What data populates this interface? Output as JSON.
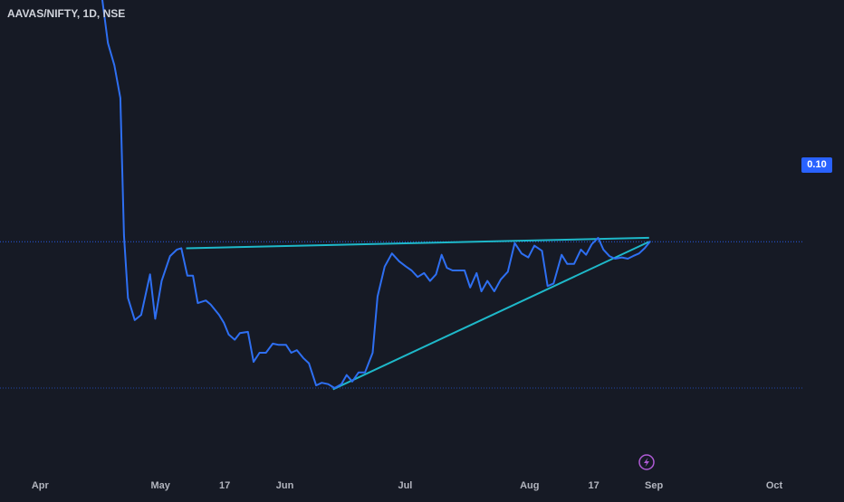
{
  "header": {
    "symbol_title": "AAVAS/NIFTY, 1D, NSE"
  },
  "price_badge": {
    "label": "0.10"
  },
  "colors": {
    "background": "#161a25",
    "series_line": "#2e6ff2",
    "trendline": "#1eb8c9",
    "dotted_line": "#2962ff",
    "lightning_icon": "#b05bd6",
    "axis_text": "#b2b5be"
  },
  "icons": {
    "event_marker": "lightning-icon"
  },
  "chart_data": {
    "type": "line",
    "title": "AAVAS/NIFTY, 1D, NSE",
    "xlabel": "",
    "ylabel": "",
    "x_ticks": [
      "Apr",
      "May",
      "17",
      "Jun",
      "Jul",
      "Aug",
      "17",
      "Sep",
      "Oct"
    ],
    "x_tick_days": [
      0,
      30,
      46,
      61,
      91,
      122,
      138,
      153,
      183
    ],
    "xlim": [
      -10,
      190
    ],
    "ylim": [
      0.0825,
      0.1185
    ],
    "grid": false,
    "legend": "none",
    "last_price": 0.1,
    "reference_lines": [
      {
        "style": "dotted",
        "y": 0.1
      },
      {
        "style": "dotted",
        "y": 0.0888
      }
    ],
    "series": [
      {
        "values": [
          [
            15.5,
            0.1185
          ],
          [
            16.9,
            0.1152
          ],
          [
            18.5,
            0.1135
          ],
          [
            20.0,
            0.111
          ],
          [
            20.9,
            0.1005
          ],
          [
            21.9,
            0.0957
          ],
          [
            23.6,
            0.094
          ],
          [
            25.2,
            0.0944
          ],
          [
            27.4,
            0.0975
          ],
          [
            28.7,
            0.0941
          ],
          [
            30.3,
            0.097
          ],
          [
            32.4,
            0.0989
          ],
          [
            34.1,
            0.0994
          ],
          [
            35.2,
            0.0995
          ],
          [
            36.7,
            0.0974
          ],
          [
            38.1,
            0.0974
          ],
          [
            39.3,
            0.0953
          ],
          [
            41.3,
            0.0955
          ],
          [
            42.5,
            0.0952
          ],
          [
            44.6,
            0.0944
          ],
          [
            45.8,
            0.0938
          ],
          [
            47.0,
            0.0929
          ],
          [
            48.5,
            0.0925
          ],
          [
            49.8,
            0.093
          ],
          [
            51.8,
            0.0931
          ],
          [
            53.2,
            0.0908
          ],
          [
            54.7,
            0.0915
          ],
          [
            56.3,
            0.0915
          ],
          [
            58.0,
            0.0922
          ],
          [
            59.5,
            0.0921
          ],
          [
            61.3,
            0.0921
          ],
          [
            62.6,
            0.0915
          ],
          [
            64.0,
            0.0917
          ],
          [
            65.6,
            0.0911
          ],
          [
            67.0,
            0.0907
          ],
          [
            68.8,
            0.089
          ],
          [
            70.2,
            0.0892
          ],
          [
            71.8,
            0.0891
          ],
          [
            73.4,
            0.0888
          ],
          [
            75.1,
            0.0891
          ],
          [
            76.4,
            0.0898
          ],
          [
            77.8,
            0.0893
          ],
          [
            79.4,
            0.09
          ],
          [
            81.0,
            0.09
          ],
          [
            82.9,
            0.0915
          ],
          [
            84.1,
            0.0958
          ],
          [
            85.9,
            0.0981
          ],
          [
            87.7,
            0.0991
          ],
          [
            89.5,
            0.0985
          ],
          [
            91.2,
            0.0981
          ],
          [
            92.6,
            0.0978
          ],
          [
            94.1,
            0.0973
          ],
          [
            95.7,
            0.0976
          ],
          [
            97.2,
            0.097
          ],
          [
            98.7,
            0.0975
          ],
          [
            100.1,
            0.099
          ],
          [
            101.4,
            0.098
          ],
          [
            102.8,
            0.0978
          ],
          [
            104.5,
            0.0978
          ],
          [
            105.8,
            0.0978
          ],
          [
            107.2,
            0.0965
          ],
          [
            108.8,
            0.0976
          ],
          [
            110.0,
            0.0962
          ],
          [
            111.5,
            0.097
          ],
          [
            113.2,
            0.0962
          ],
          [
            114.8,
            0.0971
          ],
          [
            116.6,
            0.0977
          ],
          [
            118.3,
            0.0999
          ],
          [
            120.0,
            0.0991
          ],
          [
            121.7,
            0.0988
          ],
          [
            123.2,
            0.0997
          ],
          [
            125.1,
            0.0993
          ],
          [
            126.5,
            0.0966
          ],
          [
            128.0,
            0.0968
          ],
          [
            130.0,
            0.099
          ],
          [
            131.4,
            0.0983
          ],
          [
            133.1,
            0.0983
          ],
          [
            134.8,
            0.0994
          ],
          [
            136.1,
            0.099
          ],
          [
            137.5,
            0.0998
          ],
          [
            139.1,
            0.1003
          ],
          [
            140.4,
            0.0994
          ],
          [
            141.9,
            0.0989
          ],
          [
            143.3,
            0.0987
          ],
          [
            145.0,
            0.0988
          ],
          [
            146.5,
            0.0987
          ],
          [
            147.8,
            0.0989
          ],
          [
            149.3,
            0.0991
          ],
          [
            150.7,
            0.0995
          ],
          [
            152.0,
            0.1
          ]
        ]
      }
    ],
    "trendlines": [
      {
        "name": "resistance",
        "from": [
          36.4,
          0.0995
        ],
        "to": [
          151.8,
          0.1003
        ]
      },
      {
        "name": "support",
        "from": [
          73.0,
          0.0887
        ],
        "to": [
          151.8,
          0.1
        ]
      }
    ]
  }
}
